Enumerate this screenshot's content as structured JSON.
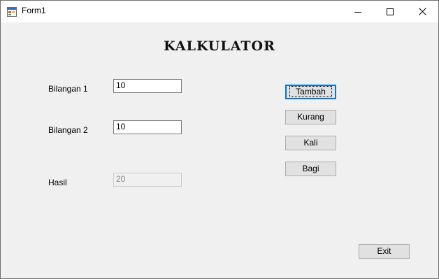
{
  "window": {
    "title": "Form1"
  },
  "heading": "KALKULATOR",
  "fields": {
    "bilangan1_label": "Bilangan 1",
    "bilangan1_value": "10",
    "bilangan2_label": "Bilangan 2",
    "bilangan2_value": "10",
    "hasil_label": "Hasil",
    "hasil_value": "20"
  },
  "buttons": {
    "tambah": "Tambah",
    "kurang": "Kurang",
    "kali": "Kali",
    "bagi": "Bagi",
    "exit": "Exit"
  },
  "icons": {
    "app": "form-app-icon",
    "minimize": "minimize-icon",
    "maximize": "maximize-icon",
    "close": "close-icon"
  },
  "colors": {
    "focus_accent": "#0078d7"
  }
}
